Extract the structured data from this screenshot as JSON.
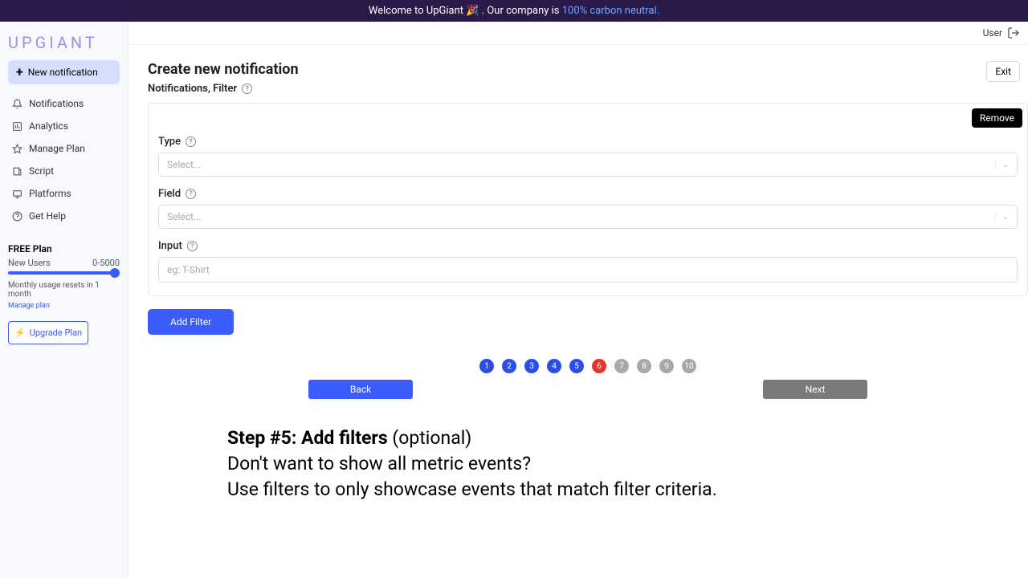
{
  "banner": {
    "prefix": "Welcome to UpGiant 🎉 . Our company is ",
    "link": "100% carbon neutral."
  },
  "logo": "UPGIANT",
  "sidebar": {
    "new_notification": "New notification",
    "items": [
      {
        "label": "Notifications"
      },
      {
        "label": "Analytics"
      },
      {
        "label": "Manage Plan"
      },
      {
        "label": "Script"
      },
      {
        "label": "Platforms"
      },
      {
        "label": "Get Help"
      }
    ],
    "plan": {
      "title": "FREE Plan",
      "metric_label": "New Users",
      "metric_range": "0-5000",
      "reset_note": "Monthly usage resets in 1 month",
      "manage_link": "Manage plan",
      "upgrade_label": "Upgrade Plan"
    }
  },
  "user": {
    "label": "User"
  },
  "page": {
    "title": "Create new notification",
    "subtitle": "Notifications, Filter",
    "exit": "Exit"
  },
  "filter": {
    "remove": "Remove",
    "type_label": "Type",
    "type_placeholder": "Select...",
    "field_label": "Field",
    "field_placeholder": "Select...",
    "input_label": "Input",
    "input_placeholder": "eg: T-Shirt",
    "add_button": "Add Filter"
  },
  "steps": {
    "total": 10,
    "current": 6
  },
  "nav": {
    "back": "Back",
    "next": "Next"
  },
  "overlay": {
    "line1_bold": "Step #5: Add filters",
    "line1_rest": " (optional)",
    "line2": "Don't want to show all metric events?",
    "line3": "Use filters to only showcase events that match filter criteria."
  }
}
